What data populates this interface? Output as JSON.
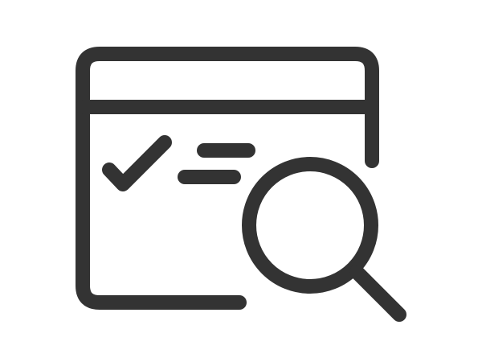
{
  "icon": {
    "name": "browser-window-search-checklist-icon",
    "parts": {
      "window": "browser-window-icon",
      "check": "checkmark-icon",
      "lines": "text-lines-icon",
      "magnifier": "magnifying-glass-icon"
    }
  },
  "colors": {
    "stroke": "#333333",
    "background": "#ffffff"
  }
}
